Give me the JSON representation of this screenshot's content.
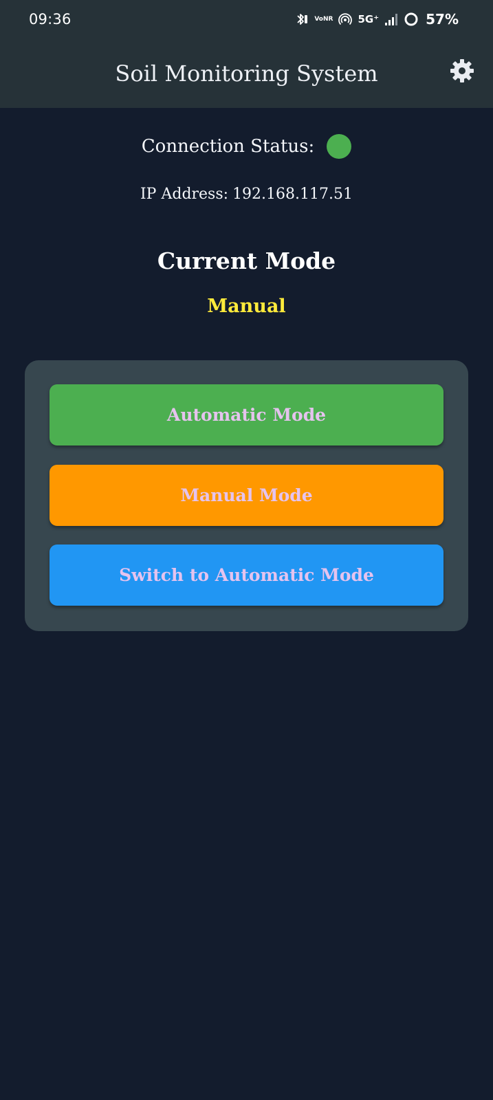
{
  "status_bar": {
    "time": "09:36",
    "volte_top": "Vo",
    "volte_bottom": "NR",
    "network": "5G⁺",
    "battery": "57%"
  },
  "header": {
    "title": "Soil Monitoring System",
    "settings_icon": "gear-icon"
  },
  "connection": {
    "label": "Connection Status:",
    "status_color": "#4caf50",
    "ip_label": "IP Address:",
    "ip_value": "192.168.117.51"
  },
  "mode": {
    "heading": "Current Mode",
    "value": "Manual",
    "value_color": "#ffeb3b"
  },
  "buttons": [
    {
      "label": "Automatic Mode",
      "color": "#4caf50"
    },
    {
      "label": "Manual Mode",
      "color": "#ff9800"
    },
    {
      "label": "Switch to Automatic Mode",
      "color": "#2196f3"
    }
  ],
  "colors": {
    "background": "#131c2d",
    "header": "#263238",
    "panel": "#37474f",
    "button_text": "#e5c3ee"
  }
}
